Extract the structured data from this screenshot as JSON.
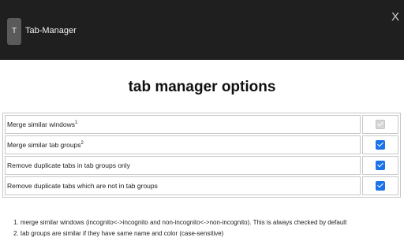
{
  "header": {
    "icon_letter": "T",
    "title": "Tab-Manager",
    "close_label": "X"
  },
  "page_title": "tab manager options",
  "options": [
    {
      "label": "Merge similar windows",
      "sup": "1",
      "checked": true,
      "disabled": true
    },
    {
      "label": "Merge similar tab groups",
      "sup": "2",
      "checked": true,
      "disabled": false
    },
    {
      "label": "Remove duplicate tabs in tab groups only",
      "sup": "",
      "checked": true,
      "disabled": false
    },
    {
      "label": "Remove duplicate tabs which are not in tab groups",
      "sup": "",
      "checked": true,
      "disabled": false
    }
  ],
  "notes": [
    "1. merge similar windows (incognito<->incognito and non-incognito<->non-incognito). This is always checked by default",
    "2. tab groups are similar if they have same name and color (case-sensitive)"
  ],
  "colors": {
    "header_bg": "#1f1f1f",
    "checkbox_accent": "#1a73e8"
  }
}
